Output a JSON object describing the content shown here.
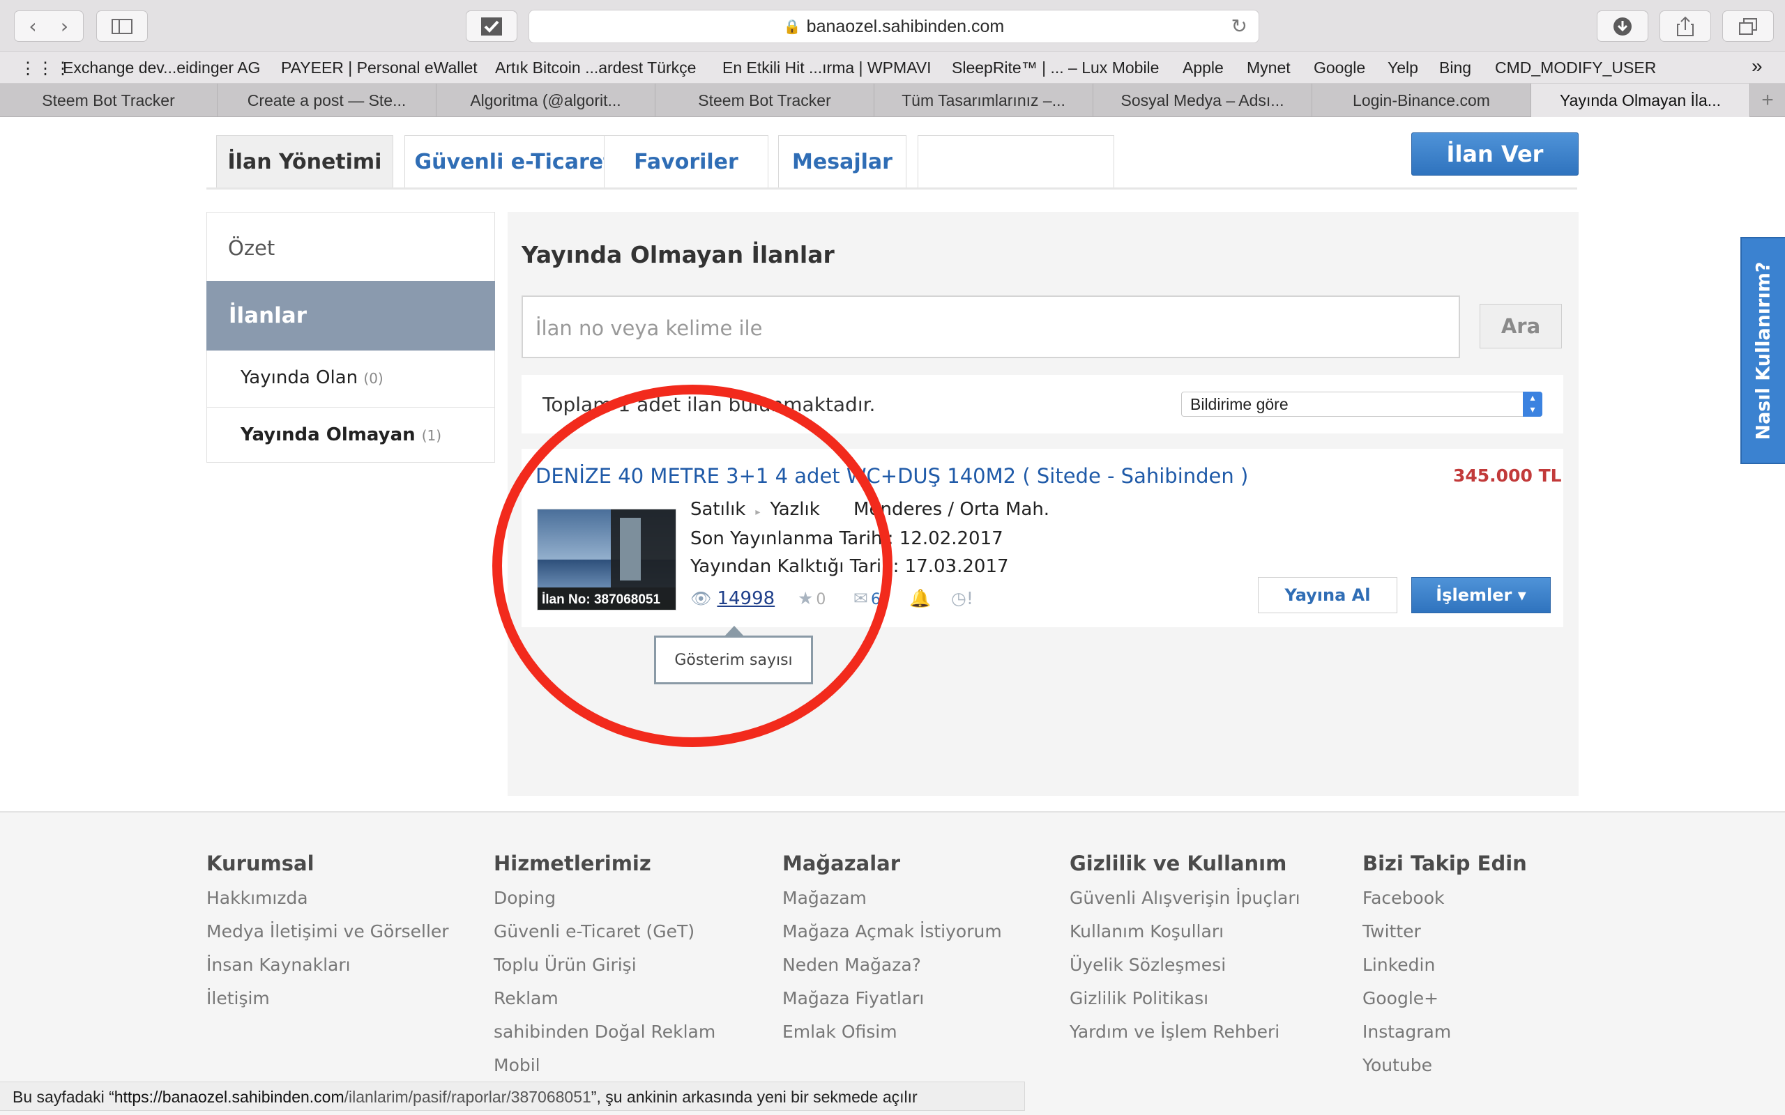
{
  "browser": {
    "url": "banaozel.sahibinden.com",
    "bookmarks": [
      "Exchange dev...eidinger AG",
      "PAYEER | Personal eWallet",
      "Artık Bitcoin ...ardest Türkçe",
      "En Etkili Hit ...ırma | WPMAVI",
      "SleepRite™ | ... – Lux Mobile",
      "Apple",
      "Mynet",
      "Google",
      "Yelp",
      "Bing",
      "CMD_MODIFY_USER"
    ],
    "tabs": [
      "Steem Bot Tracker",
      "Create a post — Ste...",
      "Algoritma (@algorit...",
      "Steem Bot Tracker",
      "Tüm Tasarımlarınız –...",
      "Sosyal Medya – Adsı...",
      "Login-Binance.com",
      "Yayında Olmayan İla..."
    ],
    "status": {
      "prefix": "Bu sayfadaki “",
      "url_host": "https://banaozel.sahibinden.com",
      "url_path": "/ilanlarim/pasif/raporlar/387068051",
      "suffix": "”, şu ankinin arkasında yeni bir sekmede açılır"
    }
  },
  "nav": {
    "tabs": [
      "İlan Yönetimi",
      "Güvenli e-Ticaret",
      "Favoriler",
      "Mesajlar"
    ],
    "cta": "İlan Ver"
  },
  "sidebar": {
    "summary": "Özet",
    "section": "İlanlar",
    "items": [
      {
        "label": "Yayında Olan",
        "count": "(0)"
      },
      {
        "label": "Yayında Olmayan",
        "count": "(1)"
      }
    ]
  },
  "main": {
    "title": "Yayında Olmayan İlanlar",
    "search_placeholder": "İlan no veya kelime ile",
    "search_button": "Ara",
    "summary": "Toplam 1 adet ilan bulunmaktadır.",
    "sort": "Bildirime göre",
    "listing": {
      "title": "DENİZE 40 METRE 3+1 4 adet WC+DUŞ 140M2 ( Sitede - Sahibinden )",
      "price": "345.000 TL",
      "type": "Satılık",
      "category": "Yazlık",
      "location": "Menderes / Orta Mah.",
      "published_label": "Son Yayınlanma Tarihi:",
      "published_value": "12.02.2017",
      "removed_label": "Yayından Kalktığı Tarih:",
      "removed_value": "17.03.2017",
      "ilan_no": "İlan No: 387068051",
      "views": "14998",
      "favorites": "0",
      "messages": "6",
      "publish_button": "Yayına Al",
      "actions_button": "İşlemler ▾",
      "tooltip": "Gösterim sayısı"
    }
  },
  "help": "Nasıl Kullanırım?",
  "footer": [
    {
      "heading": "Kurumsal",
      "links": [
        "Hakkımızda",
        "Medya İletişimi ve Görseller",
        "İnsan Kaynakları",
        "İletişim"
      ]
    },
    {
      "heading": "Hizmetlerimiz",
      "links": [
        "Doping",
        "Güvenli e-Ticaret (GeT)",
        "Toplu Ürün Girişi",
        "Reklam",
        "sahibinden Doğal Reklam",
        "Mobil"
      ]
    },
    {
      "heading": "Mağazalar",
      "links": [
        "Mağazam",
        "Mağaza Açmak İstiyorum",
        "Neden Mağaza?",
        "Mağaza Fiyatları",
        "Emlak Ofisim"
      ]
    },
    {
      "heading": "Gizlilik ve Kullanım",
      "links": [
        "Güvenli Alışverişin İpuçları",
        "Kullanım Koşulları",
        "Üyelik Sözleşmesi",
        "Gizlilik Politikası",
        "Yardım ve İşlem Rehberi"
      ]
    },
    {
      "heading": "Bizi Takip Edin",
      "links": [
        "Facebook",
        "Twitter",
        "Linkedin",
        "Google+",
        "Instagram",
        "Youtube"
      ]
    }
  ]
}
